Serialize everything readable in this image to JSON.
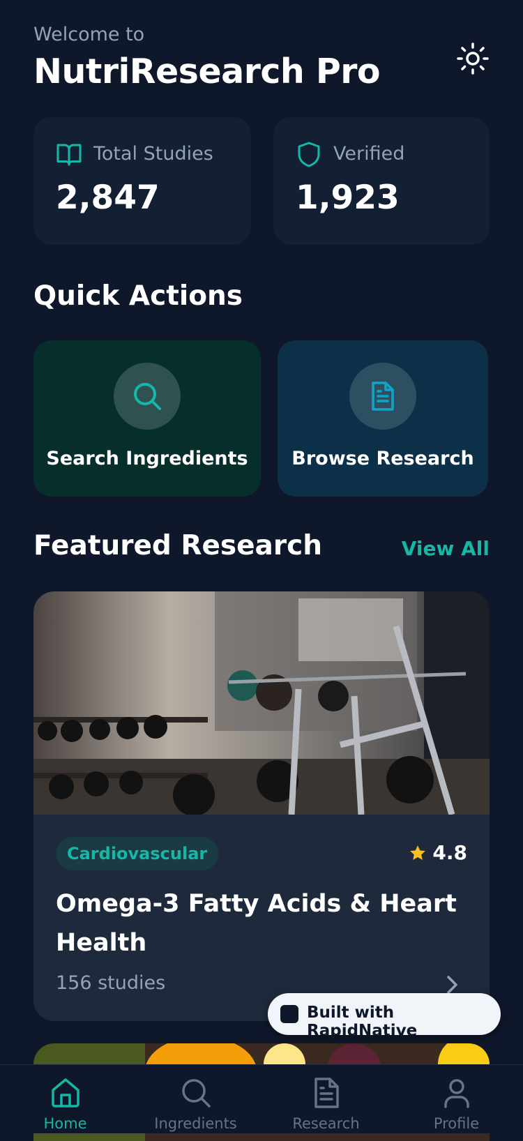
{
  "header": {
    "welcome": "Welcome to",
    "title": "NutriResearch Pro",
    "theme_icon": "sun-icon"
  },
  "stats": [
    {
      "label": "Total Studies",
      "value": "2,847",
      "icon": "book-open-icon"
    },
    {
      "label": "Verified",
      "value": "1,923",
      "icon": "shield-icon"
    }
  ],
  "quick_actions": {
    "title": "Quick Actions",
    "items": [
      {
        "label": "Search Ingredients",
        "icon": "search-icon"
      },
      {
        "label": "Browse Research",
        "icon": "document-icon"
      }
    ]
  },
  "featured": {
    "title": "Featured Research",
    "view_all": "View All",
    "card": {
      "tag": "Cardiovascular",
      "rating": "4.8",
      "title": "Omega-3 Fatty Acids & Heart Health",
      "subtitle": "156 studies"
    }
  },
  "badge": {
    "text": "Built with RapidNative"
  },
  "tabs": [
    {
      "label": "Home",
      "icon": "home-icon",
      "active": true
    },
    {
      "label": "Ingredients",
      "icon": "search-icon",
      "active": false
    },
    {
      "label": "Research",
      "icon": "document-icon",
      "active": false
    },
    {
      "label": "Profile",
      "icon": "user-icon",
      "active": false
    }
  ],
  "colors": {
    "background": "#0f172a",
    "accent": "#14b8a6",
    "card": "#1e293b",
    "star": "#fbbf24"
  }
}
